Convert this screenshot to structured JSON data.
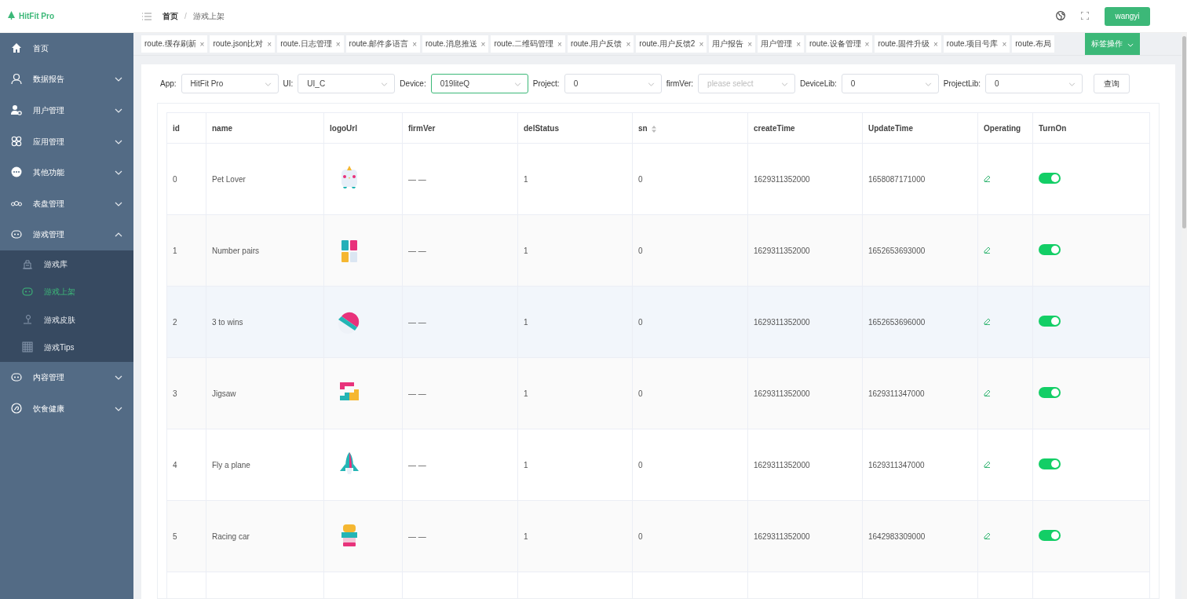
{
  "header": {
    "brand": "HitFit Pro",
    "breadcrumb": [
      "首页",
      "游戏上架"
    ],
    "breadcrumb_separator": "/",
    "user": "wangyi"
  },
  "sidebar": {
    "items": [
      {
        "label": "首页"
      },
      {
        "label": "数据报告",
        "expandable": true,
        "expanded": false
      },
      {
        "label": "用户管理",
        "expandable": true,
        "expanded": false
      },
      {
        "label": "应用管理",
        "expandable": true,
        "expanded": false
      },
      {
        "label": "其他功能",
        "expandable": true,
        "expanded": false
      },
      {
        "label": "表盘管理",
        "expandable": true,
        "expanded": false
      },
      {
        "label": "游戏管理",
        "expandable": true,
        "expanded": true,
        "children": [
          {
            "label": "游戏库",
            "selected": false
          },
          {
            "label": "游戏上架",
            "selected": true
          },
          {
            "label": "游戏皮肤",
            "selected": false
          },
          {
            "label": "游戏Tips",
            "selected": false
          }
        ]
      },
      {
        "label": "内容管理",
        "expandable": true,
        "expanded": false
      },
      {
        "label": "饮食健康",
        "expandable": true,
        "expanded": false
      }
    ]
  },
  "tabs": {
    "items": [
      {
        "label": "route.缓存刷新",
        "close": "×"
      },
      {
        "label": "route.json比对",
        "close": "×"
      },
      {
        "label": "route.日志管理",
        "close": "×"
      },
      {
        "label": "route.邮件多语言",
        "close": "×"
      },
      {
        "label": "route.消息推送",
        "close": "×"
      },
      {
        "label": "route.二维码管理",
        "close": "×"
      },
      {
        "label": "route.用户反馈",
        "close": "×"
      },
      {
        "label": "route.用户反馈2",
        "close": "×"
      },
      {
        "label": "用户报告",
        "close": "×"
      },
      {
        "label": "用户管理",
        "close": "×"
      },
      {
        "label": "route.设备管理",
        "close": "×"
      },
      {
        "label": "route.固件升级",
        "close": "×"
      },
      {
        "label": "route.项目号库",
        "close": "×"
      },
      {
        "label": "route.布局"
      }
    ],
    "actions_button": "标签操作"
  },
  "filters": [
    {
      "label": "App:",
      "value": "HitFit Pro",
      "focused": false
    },
    {
      "label": "UI:",
      "value": "UI_C",
      "focused": false
    },
    {
      "label": "Device:",
      "value": "019liteQ",
      "focused": true
    },
    {
      "label": "Project:",
      "value": "0",
      "focused": false
    },
    {
      "label": "firmVer:",
      "placeholder": "please select",
      "focused": false
    },
    {
      "label": "DeviceLib:",
      "value": "0",
      "focused": false
    },
    {
      "label": "ProjectLib:",
      "value": "0",
      "focused": false
    }
  ],
  "query_button": "查询",
  "table": {
    "columns": [
      "id",
      "name",
      "logoUrl",
      "firmVer",
      "delStatus",
      "sn",
      "createTime",
      "UpdateTime",
      "Operating",
      "TurnOn"
    ],
    "rows": [
      {
        "id": "0",
        "name": "Pet Lover",
        "firmVer": "— —",
        "delStatus": "1",
        "sn": "0",
        "createTime": "1629311352000",
        "updateTime": "1658087171000",
        "on": true,
        "highlighted": false
      },
      {
        "id": "1",
        "name": "Number pairs",
        "firmVer": "— —",
        "delStatus": "1",
        "sn": "0",
        "createTime": "1629311352000",
        "updateTime": "1652653693000",
        "on": true,
        "highlighted": false
      },
      {
        "id": "2",
        "name": "3 to wins",
        "firmVer": "— —",
        "delStatus": "1",
        "sn": "0",
        "createTime": "1629311352000",
        "updateTime": "1652653696000",
        "on": true,
        "highlighted": true
      },
      {
        "id": "3",
        "name": "Jigsaw",
        "firmVer": "— —",
        "delStatus": "1",
        "sn": "0",
        "createTime": "1629311352000",
        "updateTime": "1629311347000",
        "on": true,
        "highlighted": false
      },
      {
        "id": "4",
        "name": "Fly a plane",
        "firmVer": "— —",
        "delStatus": "1",
        "sn": "0",
        "createTime": "1629311352000",
        "updateTime": "1629311347000",
        "on": true,
        "highlighted": false
      },
      {
        "id": "5",
        "name": "Racing car",
        "firmVer": "— —",
        "delStatus": "1",
        "sn": "0",
        "createTime": "1629311352000",
        "updateTime": "1642983309000",
        "on": true,
        "highlighted": false
      }
    ]
  }
}
